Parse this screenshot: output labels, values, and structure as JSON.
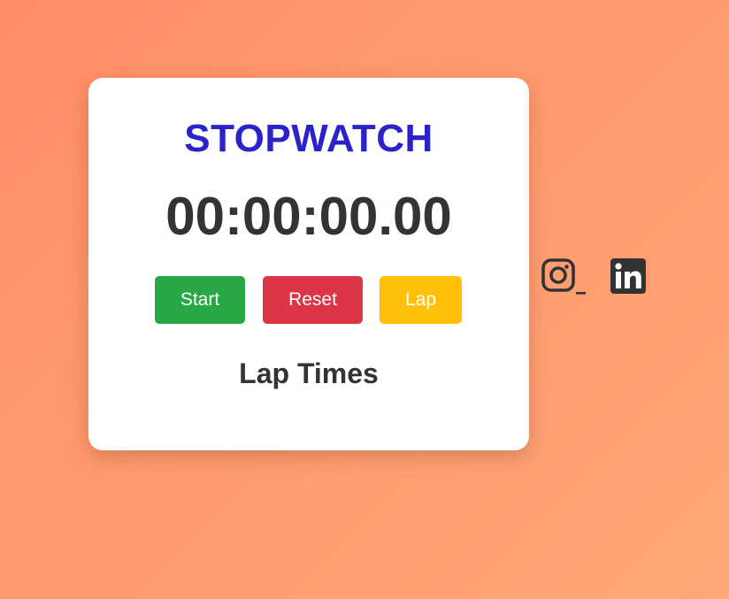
{
  "stopwatch": {
    "title": "STOPWATCH",
    "display": "00:00:00.00",
    "buttons": {
      "start": "Start",
      "reset": "Reset",
      "lap": "Lap"
    },
    "lap_times_heading": "Lap Times",
    "laps": []
  },
  "social": {
    "icons": [
      "instagram-icon",
      "linkedin-icon"
    ]
  },
  "colors": {
    "title": "#2b22c9",
    "start": "#28a745",
    "reset": "#dc3545",
    "lap": "#ffc107",
    "text": "#333333",
    "background_from": "#ff8c66",
    "background_to": "#ffa876"
  }
}
